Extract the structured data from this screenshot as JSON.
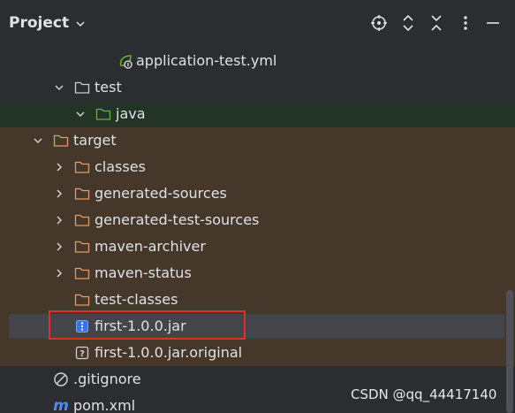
{
  "header": {
    "title": "Project",
    "buttons": [
      "locate-icon",
      "expand-all-icon",
      "collapse-all-icon",
      "more-options-icon",
      "hide-icon"
    ]
  },
  "tree": {
    "items": [
      {
        "label": "application-test.yml",
        "icon": "spring-config-icon",
        "expanded": null,
        "highlight": "none"
      },
      {
        "label": "test",
        "icon": "folder-icon",
        "expanded": true,
        "highlight": "none"
      },
      {
        "label": "java",
        "icon": "test-folder-icon",
        "expanded": true,
        "highlight": "green"
      },
      {
        "label": "target",
        "icon": "folder-icon",
        "expanded": true,
        "highlight": "brown"
      },
      {
        "label": "classes",
        "icon": "folder-icon",
        "expanded": false,
        "highlight": "brown"
      },
      {
        "label": "generated-sources",
        "icon": "folder-icon",
        "expanded": false,
        "highlight": "brown"
      },
      {
        "label": "generated-test-sources",
        "icon": "folder-icon",
        "expanded": false,
        "highlight": "brown"
      },
      {
        "label": "maven-archiver",
        "icon": "folder-icon",
        "expanded": false,
        "highlight": "brown"
      },
      {
        "label": "maven-status",
        "icon": "folder-icon",
        "expanded": false,
        "highlight": "brown"
      },
      {
        "label": "test-classes",
        "icon": "folder-icon",
        "expanded": null,
        "highlight": "brown"
      },
      {
        "label": "first-1.0.0.jar",
        "icon": "jar-icon",
        "expanded": null,
        "highlight": "brown",
        "selected": true
      },
      {
        "label": "first-1.0.0.jar.original",
        "icon": "unknown-file-icon",
        "expanded": null,
        "highlight": "brown"
      },
      {
        "label": ".gitignore",
        "icon": "gitignore-icon",
        "expanded": null,
        "highlight": "none"
      },
      {
        "label": "pom.xml",
        "icon": "maven-icon",
        "expanded": null,
        "highlight": "none"
      }
    ]
  },
  "watermark": "CSDN @qq_44417140",
  "colors": {
    "background": "#2b2d30",
    "excluded_folder_bg": "#45382a",
    "test_folder_bg": "#233325",
    "selection": "#43454a",
    "annotation_box": "#e0302a",
    "jar_icon": "#548af7"
  }
}
